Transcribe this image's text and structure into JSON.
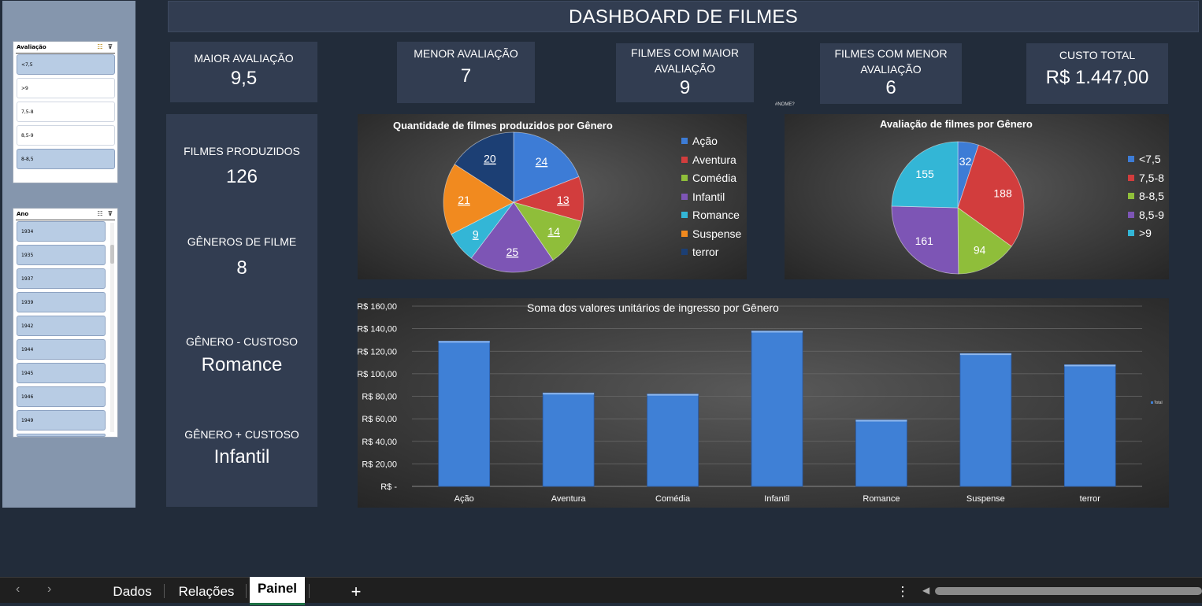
{
  "title": "DASHBOARD DE FILMES",
  "slicers": {
    "avaliacao": {
      "title": "Avaliação",
      "items": [
        {
          "label": "<7,5",
          "selected": true
        },
        {
          "label": ">9",
          "selected": false
        },
        {
          "label": "7,5-8",
          "selected": false
        },
        {
          "label": "8,5-9",
          "selected": false
        },
        {
          "label": "8-8,5",
          "selected": true
        }
      ]
    },
    "ano": {
      "title": "Ano",
      "items": [
        "1934",
        "1935",
        "1937",
        "1939",
        "1942",
        "1944",
        "1945",
        "1946",
        "1949"
      ]
    }
  },
  "kpis": {
    "maior_avaliacao": {
      "label": "MAIOR AVALIAÇÃO",
      "value": "9,5"
    },
    "menor_avaliacao": {
      "label": "MENOR AVALIAÇÃO",
      "value": "7"
    },
    "filmes_maior": {
      "label_1": "FILMES COM MAIOR",
      "label_2": "AVALIAÇÃO",
      "value": "9"
    },
    "filmes_menor": {
      "label_1": "FILMES COM MENOR",
      "label_2": "AVALIAÇÃO",
      "value": "6"
    },
    "custo_total": {
      "label": "CUSTO TOTAL",
      "value": "R$ 1.447,00"
    }
  },
  "side_stats": {
    "filmes_produzidos": {
      "label": "FILMES PRODUZIDOS",
      "value": "126"
    },
    "generos": {
      "label": "GÊNEROS DE FILME",
      "value": "8"
    },
    "genero_menos_custoso": {
      "label": "GÊNERO - CUSTOSO",
      "value": "Romance"
    },
    "genero_mais_custoso": {
      "label": "GÊNERO + CUSTOSO",
      "value": "Infantil"
    }
  },
  "name_error": "#NOME?",
  "chart_data": [
    {
      "type": "pie",
      "title": "Quantidade de filmes produzidos por Gênero",
      "categories": [
        "Ação",
        "Aventura",
        "Comédia",
        "Infantil",
        "Romance",
        "Suspense",
        "terror"
      ],
      "values": [
        24,
        13,
        14,
        25,
        9,
        21,
        20
      ],
      "colors": [
        "#3d7cd6",
        "#d23d3d",
        "#8fbe3a",
        "#7d55b5",
        "#33b6d6",
        "#f18a1f",
        "#1c3f74"
      ],
      "legend": "right"
    },
    {
      "type": "pie",
      "title": "Avaliação de filmes por Gênero",
      "categories": [
        "<7,5",
        "7,5-8",
        "8-8,5",
        "8,5-9",
        ">9"
      ],
      "values": [
        32,
        188,
        94,
        161,
        155
      ],
      "colors": [
        "#3d7cd6",
        "#d23d3d",
        "#8fbe3a",
        "#7d55b5",
        "#33b6d6"
      ],
      "legend": "right"
    },
    {
      "type": "bar",
      "title": "Soma dos valores unitários de ingresso por Gênero",
      "categories": [
        "Ação",
        "Aventura",
        "Comédia",
        "Infantil",
        "Romance",
        "Suspense",
        "terror"
      ],
      "series": [
        {
          "name": "Total",
          "values": [
            129,
            83,
            82,
            138,
            59,
            118,
            108
          ]
        }
      ],
      "ylim": [
        0,
        160
      ],
      "yticks": [
        "R$ -",
        "R$ 20,00",
        "R$ 40,00",
        "R$ 60,00",
        "R$ 80,00",
        "R$ 100,00",
        "R$ 120,00",
        "R$ 140,00",
        "R$ 160,00"
      ],
      "grid": true,
      "legend": "right",
      "color": "#3f80d6"
    }
  ],
  "tabs": {
    "sheets": [
      "Dados",
      "Relações",
      "Painel"
    ],
    "active": "Painel",
    "add": "+",
    "more": "⋮",
    "prev": "‹",
    "next": "›"
  }
}
